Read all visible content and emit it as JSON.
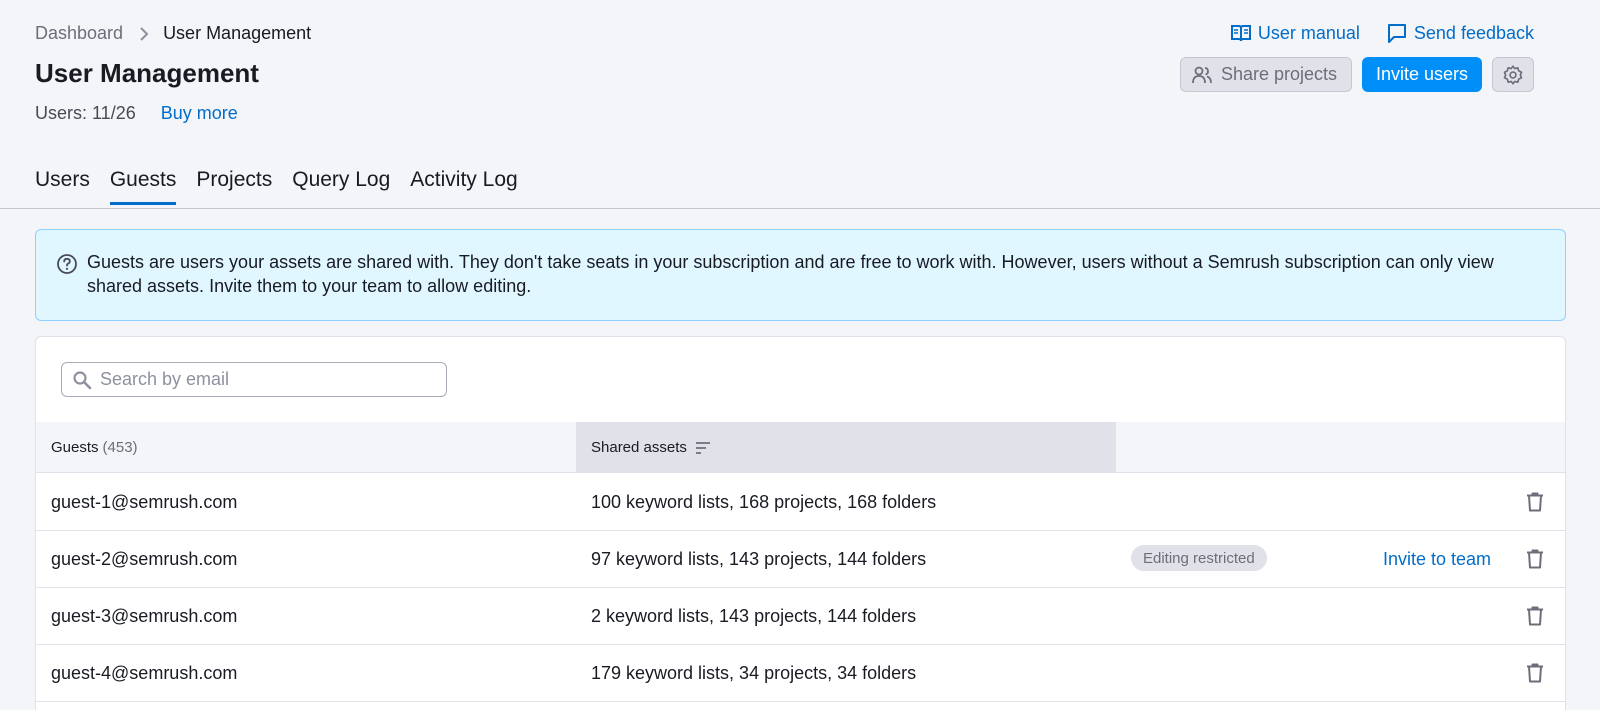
{
  "breadcrumb": {
    "parent": "Dashboard",
    "current": "User Management"
  },
  "page": {
    "title": "User Management",
    "users_label": "Users: 11/26",
    "buy_more": "Buy more"
  },
  "top_links": {
    "manual": "User manual",
    "feedback": "Send feedback"
  },
  "actions": {
    "share": "Share projects",
    "invite": "Invite users"
  },
  "tabs": [
    {
      "label": "Users",
      "active": false
    },
    {
      "label": "Guests",
      "active": true
    },
    {
      "label": "Projects",
      "active": false
    },
    {
      "label": "Query Log",
      "active": false
    },
    {
      "label": "Activity Log",
      "active": false
    }
  ],
  "info": {
    "text": "Guests are users your assets are shared with. They don't take seats in your subscription and are free to work with. However, users without a Semrush subscription can only view shared assets. Invite them to your team to allow editing."
  },
  "search": {
    "placeholder": "Search by email"
  },
  "table": {
    "headers": {
      "guests": "Guests",
      "guests_count": "(453)",
      "assets": "Shared assets"
    },
    "rows": [
      {
        "email": "guest-1@semrush.com",
        "assets": "100 keyword lists, 168 projects, 168 folders",
        "badge": "",
        "action": ""
      },
      {
        "email": "guest-2@semrush.com",
        "assets": "97 keyword lists, 143 projects, 144 folders",
        "badge": "Editing restricted",
        "action": "Invite to team"
      },
      {
        "email": "guest-3@semrush.com",
        "assets": "2 keyword lists, 143 projects, 144 folders",
        "badge": "",
        "action": ""
      },
      {
        "email": "guest-4@semrush.com",
        "assets": "179 keyword lists, 34 projects, 34 folders",
        "badge": "",
        "action": ""
      }
    ]
  },
  "colors": {
    "accent": "#008ff8",
    "link": "#006dca",
    "info_bg": "#e0f7ff",
    "info_border": "#8ed0ff"
  }
}
